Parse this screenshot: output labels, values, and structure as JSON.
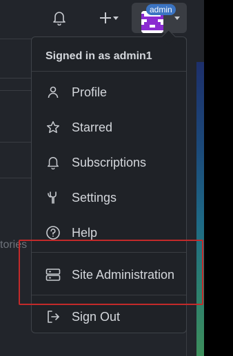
{
  "header": {
    "bell_icon": "bell-icon",
    "plus_icon": "plus-icon",
    "admin_badge": "admin"
  },
  "background": {
    "faded_text": "tories"
  },
  "dropdown": {
    "signed_in_label": "Signed in as admin1",
    "items": [
      {
        "label": "Profile",
        "icon": "person-icon"
      },
      {
        "label": "Starred",
        "icon": "star-icon"
      },
      {
        "label": "Subscriptions",
        "icon": "bell-icon"
      },
      {
        "label": "Settings",
        "icon": "tools-icon"
      },
      {
        "label": "Help",
        "icon": "question-icon"
      },
      {
        "label": "Site Administration",
        "icon": "server-icon"
      },
      {
        "label": "Sign Out",
        "icon": "sign-out-icon"
      }
    ]
  },
  "colors": {
    "highlight": "#c32a2a",
    "admin_badge": "#3b74c2"
  }
}
